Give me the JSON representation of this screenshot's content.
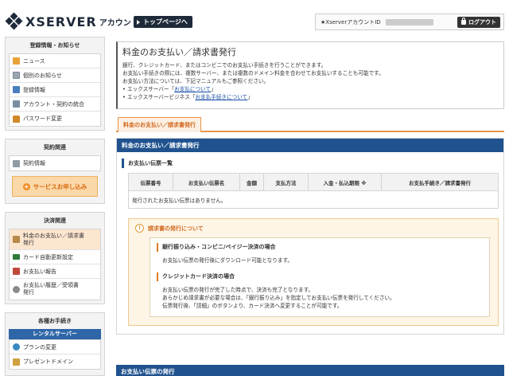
{
  "header": {
    "brand": "XSERVER",
    "brand_sub": "アカウント",
    "top_page_button": "トップページへ",
    "account_label": "★XserverアカウントID",
    "logout_button": "ログアウト"
  },
  "sidebar": {
    "section1": {
      "title": "登録情報・お知らせ",
      "items": [
        {
          "label": "ニュース",
          "icon": "news-icon"
        },
        {
          "label": "個別のお知らせ",
          "icon": "message-icon"
        },
        {
          "label": "登録情報",
          "icon": "registration-icon"
        },
        {
          "label": "アカウント・契約の統合",
          "icon": "account-merge-icon"
        },
        {
          "label": "パスワード変更",
          "icon": "password-icon"
        }
      ]
    },
    "section2": {
      "title": "契約関連",
      "items": [
        {
          "label": "契約情報",
          "icon": "contract-icon"
        }
      ],
      "service_button": "サービスお申し込み"
    },
    "section3": {
      "title": "決済関連",
      "items": [
        {
          "label": "料金のお支払い／請求書発行",
          "icon": "payment-icon"
        },
        {
          "label": "カード自動更新設定",
          "icon": "card-icon"
        },
        {
          "label": "お支払い報告",
          "icon": "report-icon"
        },
        {
          "label": "お支払い履歴／受領書発行",
          "icon": "history-icon"
        }
      ]
    },
    "section4": {
      "title": "各種お手続き",
      "rental_bar": "レンタルサーバー",
      "items": [
        {
          "label": "プランの変更",
          "icon": "plan-icon"
        },
        {
          "label": "プレゼントドメイン",
          "icon": "domain-icon"
        }
      ]
    }
  },
  "main": {
    "title": "料金のお支払い／請求書発行",
    "intro": [
      "銀行、クレジットカード、またはコンビニでのお支払い手続きを行うことができます。",
      "お支払い手続きの際には、複数サーバー、または複数のドメイン料金を合わせてお支払いすることも可能です。",
      "お支払い方法については、下記マニュアルもご参照ください。"
    ],
    "links": [
      {
        "prefix": "エックスサーバー「",
        "link": "お支払について",
        "suffix": "」"
      },
      {
        "prefix": "エックスサーバービジネス「",
        "link": "お支払手続きについて",
        "suffix": "」"
      }
    ],
    "tab": "料金のお支払い／請求書発行",
    "panel_title": "料金のお支払い／請求書発行",
    "slip_heading": "お支払い伝票一覧",
    "table": {
      "columns": [
        "伝票番号",
        "お支払い伝票名",
        "金額",
        "支払方法",
        "入金・払込期限 ※",
        "お支払手続き／請求書発行"
      ],
      "empty_message": "発行されたお支払い伝票はありません。"
    },
    "notice": {
      "title": "請求書の発行について",
      "blocks": [
        {
          "heading": "銀行振り込み・コンビニ/ペイジー決済の場合",
          "lines": [
            "お支払い伝票の発行後にダウンロード可能となります。"
          ]
        },
        {
          "heading": "クレジットカード決済の場合",
          "lines": [
            "お支払い伝票の発行が完了した時点で、決済も完了となります。",
            "あらかじめ請求書が必要な場合は、「銀行振り込み」を指定してお支払い伝票を発行してください。",
            "伝票発行後、「詳細」のボタンより、カード決済へ変更することが可能です。"
          ]
        }
      ]
    },
    "panel2_title": "お支払い伝票の発行"
  }
}
